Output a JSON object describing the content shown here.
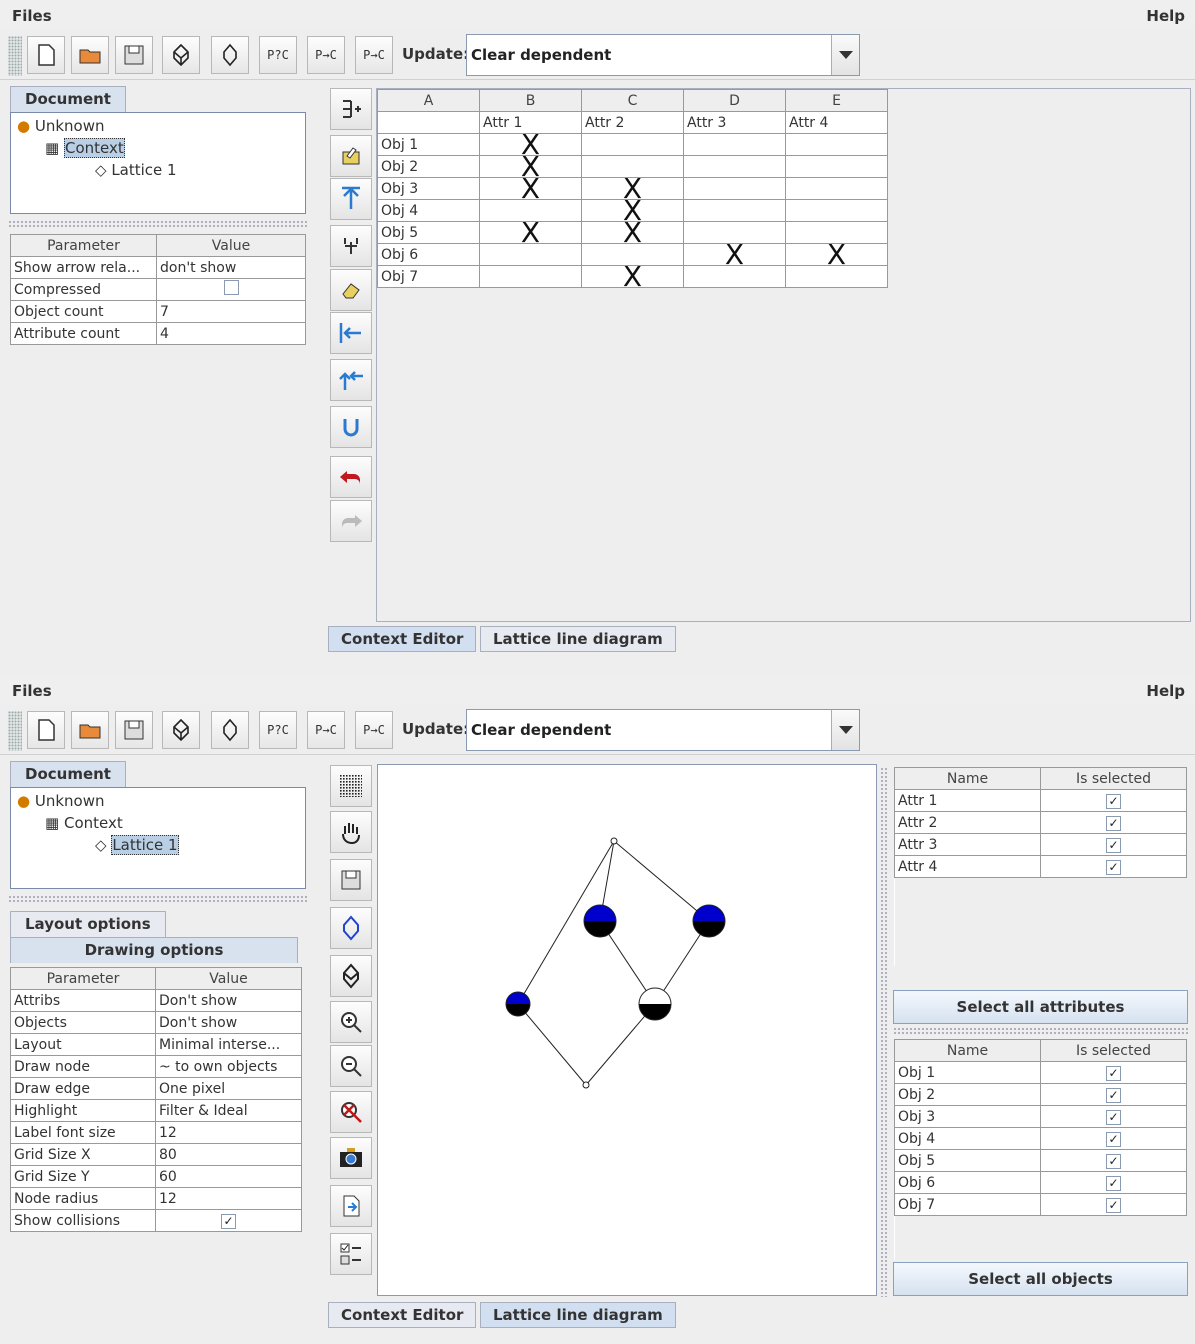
{
  "menu": {
    "files": "Files",
    "help": "Help"
  },
  "toolbar": {
    "btn_pqc": "P?C",
    "btn_pc": "P→C",
    "btn_ppc": "P→C",
    "update_label": "Update:",
    "update_value": "Clear dependent"
  },
  "tree": {
    "tab": "Document",
    "root": "Unknown",
    "context": "Context",
    "lattice": "Lattice 1"
  },
  "ctx_params": {
    "header": [
      "Parameter",
      "Value"
    ],
    "rows": [
      {
        "param": "Show arrow rela...",
        "value": "don't show"
      },
      {
        "param": "Compressed",
        "value": ""
      },
      {
        "param": "Object count",
        "value": "7"
      },
      {
        "param": "Attribute count",
        "value": "4"
      }
    ]
  },
  "context_table": {
    "letters": [
      "A",
      "B",
      "C",
      "D",
      "E"
    ],
    "attrs": [
      "Attr 1",
      "Attr 2",
      "Attr 3",
      "Attr 4"
    ],
    "objects": [
      {
        "name": "Obj 1",
        "marks": [
          "X",
          "",
          "",
          ""
        ]
      },
      {
        "name": "Obj 2",
        "marks": [
          "X",
          "",
          "",
          ""
        ]
      },
      {
        "name": "Obj 3",
        "marks": [
          "X",
          "X",
          "",
          ""
        ]
      },
      {
        "name": "Obj 4",
        "marks": [
          "",
          "X",
          "",
          ""
        ]
      },
      {
        "name": "Obj 5",
        "marks": [
          "X",
          "X",
          "",
          ""
        ]
      },
      {
        "name": "Obj 6",
        "marks": [
          "",
          "",
          "X",
          "X"
        ]
      },
      {
        "name": "Obj 7",
        "marks": [
          "",
          "X",
          "",
          ""
        ]
      }
    ]
  },
  "bottom_tabs": {
    "context_editor": "Context Editor",
    "lattice": "Lattice line diagram"
  },
  "left_tabs": {
    "layout": "Layout options",
    "drawing": "Drawing options"
  },
  "drawing_params": {
    "header": [
      "Parameter",
      "Value"
    ],
    "rows": [
      {
        "param": "Attribs",
        "value": "Don't show"
      },
      {
        "param": "Objects",
        "value": "Don't show"
      },
      {
        "param": "Layout",
        "value": "Minimal interse..."
      },
      {
        "param": "Draw node",
        "value": "~ to own objects"
      },
      {
        "param": "Draw edge",
        "value": "One pixel"
      },
      {
        "param": "Highlight",
        "value": "Filter & Ideal"
      },
      {
        "param": "Label font size",
        "value": "12"
      },
      {
        "param": "Grid Size X",
        "value": "80"
      },
      {
        "param": "Grid Size Y",
        "value": "60"
      },
      {
        "param": "Node radius",
        "value": "12"
      },
      {
        "param": "Show collisions",
        "value": ""
      }
    ]
  },
  "attr_select": {
    "header": [
      "Name",
      "Is selected"
    ],
    "rows": [
      "Attr 1",
      "Attr 2",
      "Attr 3",
      "Attr 4"
    ],
    "button": "Select all attributes"
  },
  "obj_select": {
    "header": [
      "Name",
      "Is selected"
    ],
    "rows": [
      "Obj 1",
      "Obj 2",
      "Obj 3",
      "Obj 4",
      "Obj 5",
      "Obj 6",
      "Obj 7"
    ],
    "button": "Select all objects"
  },
  "colors": {
    "node_fill": "#0000cc",
    "node_bottom": "#000000",
    "selection": "#b8cfe5"
  }
}
